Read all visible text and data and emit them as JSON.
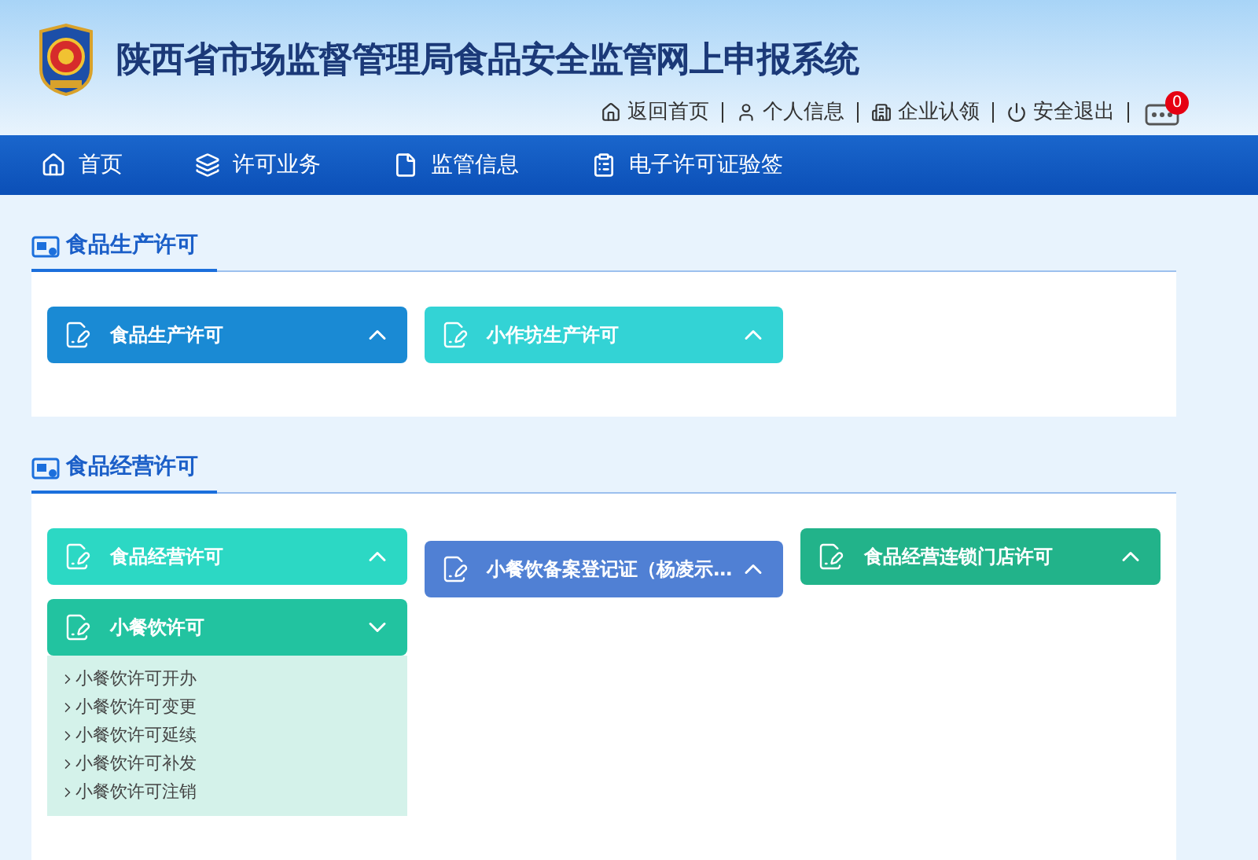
{
  "header": {
    "title": "陕西省市场监督管理局食品安全监管网上申报系统",
    "links": [
      {
        "kind": "home",
        "label": "返回首页"
      },
      {
        "kind": "user",
        "label": "个人信息"
      },
      {
        "kind": "company",
        "label": "企业认领"
      },
      {
        "kind": "logout",
        "label": "安全退出"
      }
    ],
    "message_count": "0"
  },
  "nav": [
    {
      "kind": "home",
      "label": "首页"
    },
    {
      "kind": "layers",
      "label": "许可业务"
    },
    {
      "kind": "folder",
      "label": "监管信息"
    },
    {
      "kind": "doc",
      "label": "电子许可证验签"
    }
  ],
  "sections": [
    {
      "title": "食品生产许可",
      "columns": [
        [
          {
            "label": "食品生产许可",
            "color": "#1a8ad4",
            "expanded": false
          }
        ],
        [
          {
            "label": "小作坊生产许可",
            "color": "#33d3d5",
            "expanded": false
          }
        ]
      ]
    },
    {
      "title": "食品经营许可",
      "columns": [
        [
          {
            "label": "食品经营许可",
            "color": "#2cd8c4",
            "expanded": false
          },
          {
            "label": "小餐饮许可",
            "color": "#22c3a0",
            "expanded": true,
            "items": [
              "小餐饮许可开办",
              "小餐饮许可变更",
              "小餐饮许可延续",
              "小餐饮许可补发",
              "小餐饮许可注销"
            ]
          }
        ],
        [
          {
            "label": "小餐饮备案登记证（杨凌示…",
            "color": "#5080d4",
            "expanded": false
          }
        ],
        [
          {
            "label": "食品经营连锁门店许可",
            "color": "#22b38a",
            "expanded": false
          }
        ]
      ]
    }
  ]
}
